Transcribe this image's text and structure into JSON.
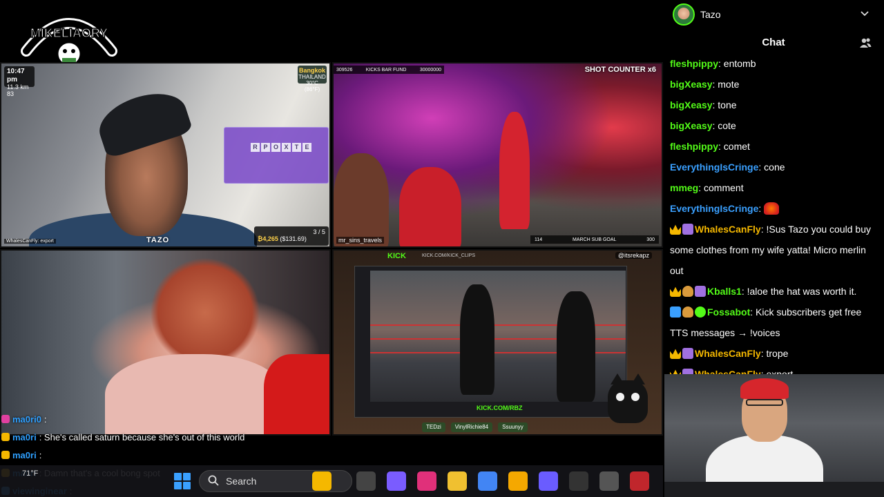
{
  "stream": {
    "logo_text": "MIKELIAORY",
    "top_left": {
      "time": "10:47 pm",
      "meta_line1": "11.3 km",
      "meta_line2": "83",
      "city": "Bangkok",
      "country": "THAILAND",
      "temp": "30°C (86°F)",
      "puzzle_letters": [
        "R",
        "P",
        "O",
        "X",
        "T",
        "E"
      ],
      "puzzle_progress": "3 / 5",
      "puzzle_amount": "₿4,265",
      "puzzle_amount_usd": "($131.69)",
      "streamer_tag": "TAZO",
      "cam_credit": "WhalesCanFly: export"
    },
    "top_right": {
      "kick_bar_left": "309526",
      "kick_bar_mid": "KICKS BAR FUND",
      "kick_bar_right": "30000000",
      "shot_counter": "SHOT COUNTER x6",
      "handle": "mr_sins_travels",
      "goal_label": "MARCH SUB GOAL",
      "goal_current": "114",
      "goal_target": "300"
    },
    "bottom_right": {
      "kick_logo": "KICK",
      "kick_url_top": "KICK.COM/KICK_CLIPS",
      "streamer_tag": "@itsrekapz",
      "kick_url_bottom": "KICK.COM/RBZ",
      "bottom_names": [
        "TEDzi",
        "VinylRichie84",
        "Ssuunyy"
      ]
    },
    "overlay_chat": [
      {
        "user": "ma0ri0",
        "text": ":",
        "badge_color": "#e040a0"
      },
      {
        "user": "ma0ri",
        "text": ": She's called saturn because she's out of this world",
        "badge_color": "#f5b800"
      },
      {
        "user": "ma0ri",
        "text": ":",
        "badge_color": "#f5b800"
      },
      {
        "user": "ma0ri",
        "text": ": Damn that's a cool bong spot",
        "badge_color": "#f5b800"
      },
      {
        "user": "viewinginear",
        "text": ":",
        "badge_color": "#3aa0ff"
      }
    ]
  },
  "taskbar": {
    "weather": "71°F",
    "search_placeholder": "Search",
    "icons": [
      "widgets-icon",
      "task-view-icon",
      "copilot-icon",
      "app-icon",
      "file-explorer-icon",
      "chrome-icon",
      "sun-app-icon",
      "vpn-icon",
      "obs-icon",
      "camera-app-icon",
      "red-app-icon"
    ]
  },
  "panel": {
    "profile_name": "Tazo",
    "chat_title": "Chat",
    "messages": [
      {
        "user": "fleshpippy",
        "color": "#53fc18",
        "text": "entomb",
        "badges": []
      },
      {
        "user": "bigXeasy",
        "color": "#53fc18",
        "text": "mote",
        "badges": []
      },
      {
        "user": "bigXeasy",
        "color": "#53fc18",
        "text": "tone",
        "badges": []
      },
      {
        "user": "bigXeasy",
        "color": "#53fc18",
        "text": "cote",
        "badges": []
      },
      {
        "user": "fleshpippy",
        "color": "#53fc18",
        "text": "comet",
        "badges": []
      },
      {
        "user": "EverythingIsCringe",
        "color": "#3aa0ff",
        "text": "cone",
        "badges": []
      },
      {
        "user": "mmeg",
        "color": "#53fc18",
        "text": "comment",
        "badges": []
      },
      {
        "user": "EverythingIsCringe",
        "color": "#3aa0ff",
        "text": "",
        "badges": [],
        "emote": true
      },
      {
        "user": "WhalesCanFly",
        "color": "#f5b800",
        "text": "!Sus Tazo you could buy some clothes from my wife yatta! Micro merlin out",
        "badges": [
          "crown",
          "gift"
        ]
      },
      {
        "user": "Kballs1",
        "color": "#53fc18",
        "text": "!aloe the hat was worth it.",
        "badges": [
          "crown",
          "burger",
          "gift"
        ]
      },
      {
        "user": "Fossabot",
        "color": "#53fc18",
        "text": "Kick subscribers get free TTS messages → !voices",
        "badges": [
          "sword",
          "burger",
          "verified"
        ]
      },
      {
        "user": "WhalesCanFly",
        "color": "#f5b800",
        "text": "trope",
        "badges": [
          "crown",
          "gift"
        ]
      },
      {
        "user": "WhalesCanFly",
        "color": "#f5b800",
        "text": "export",
        "badges": [
          "crown",
          "gift"
        ]
      }
    ]
  }
}
